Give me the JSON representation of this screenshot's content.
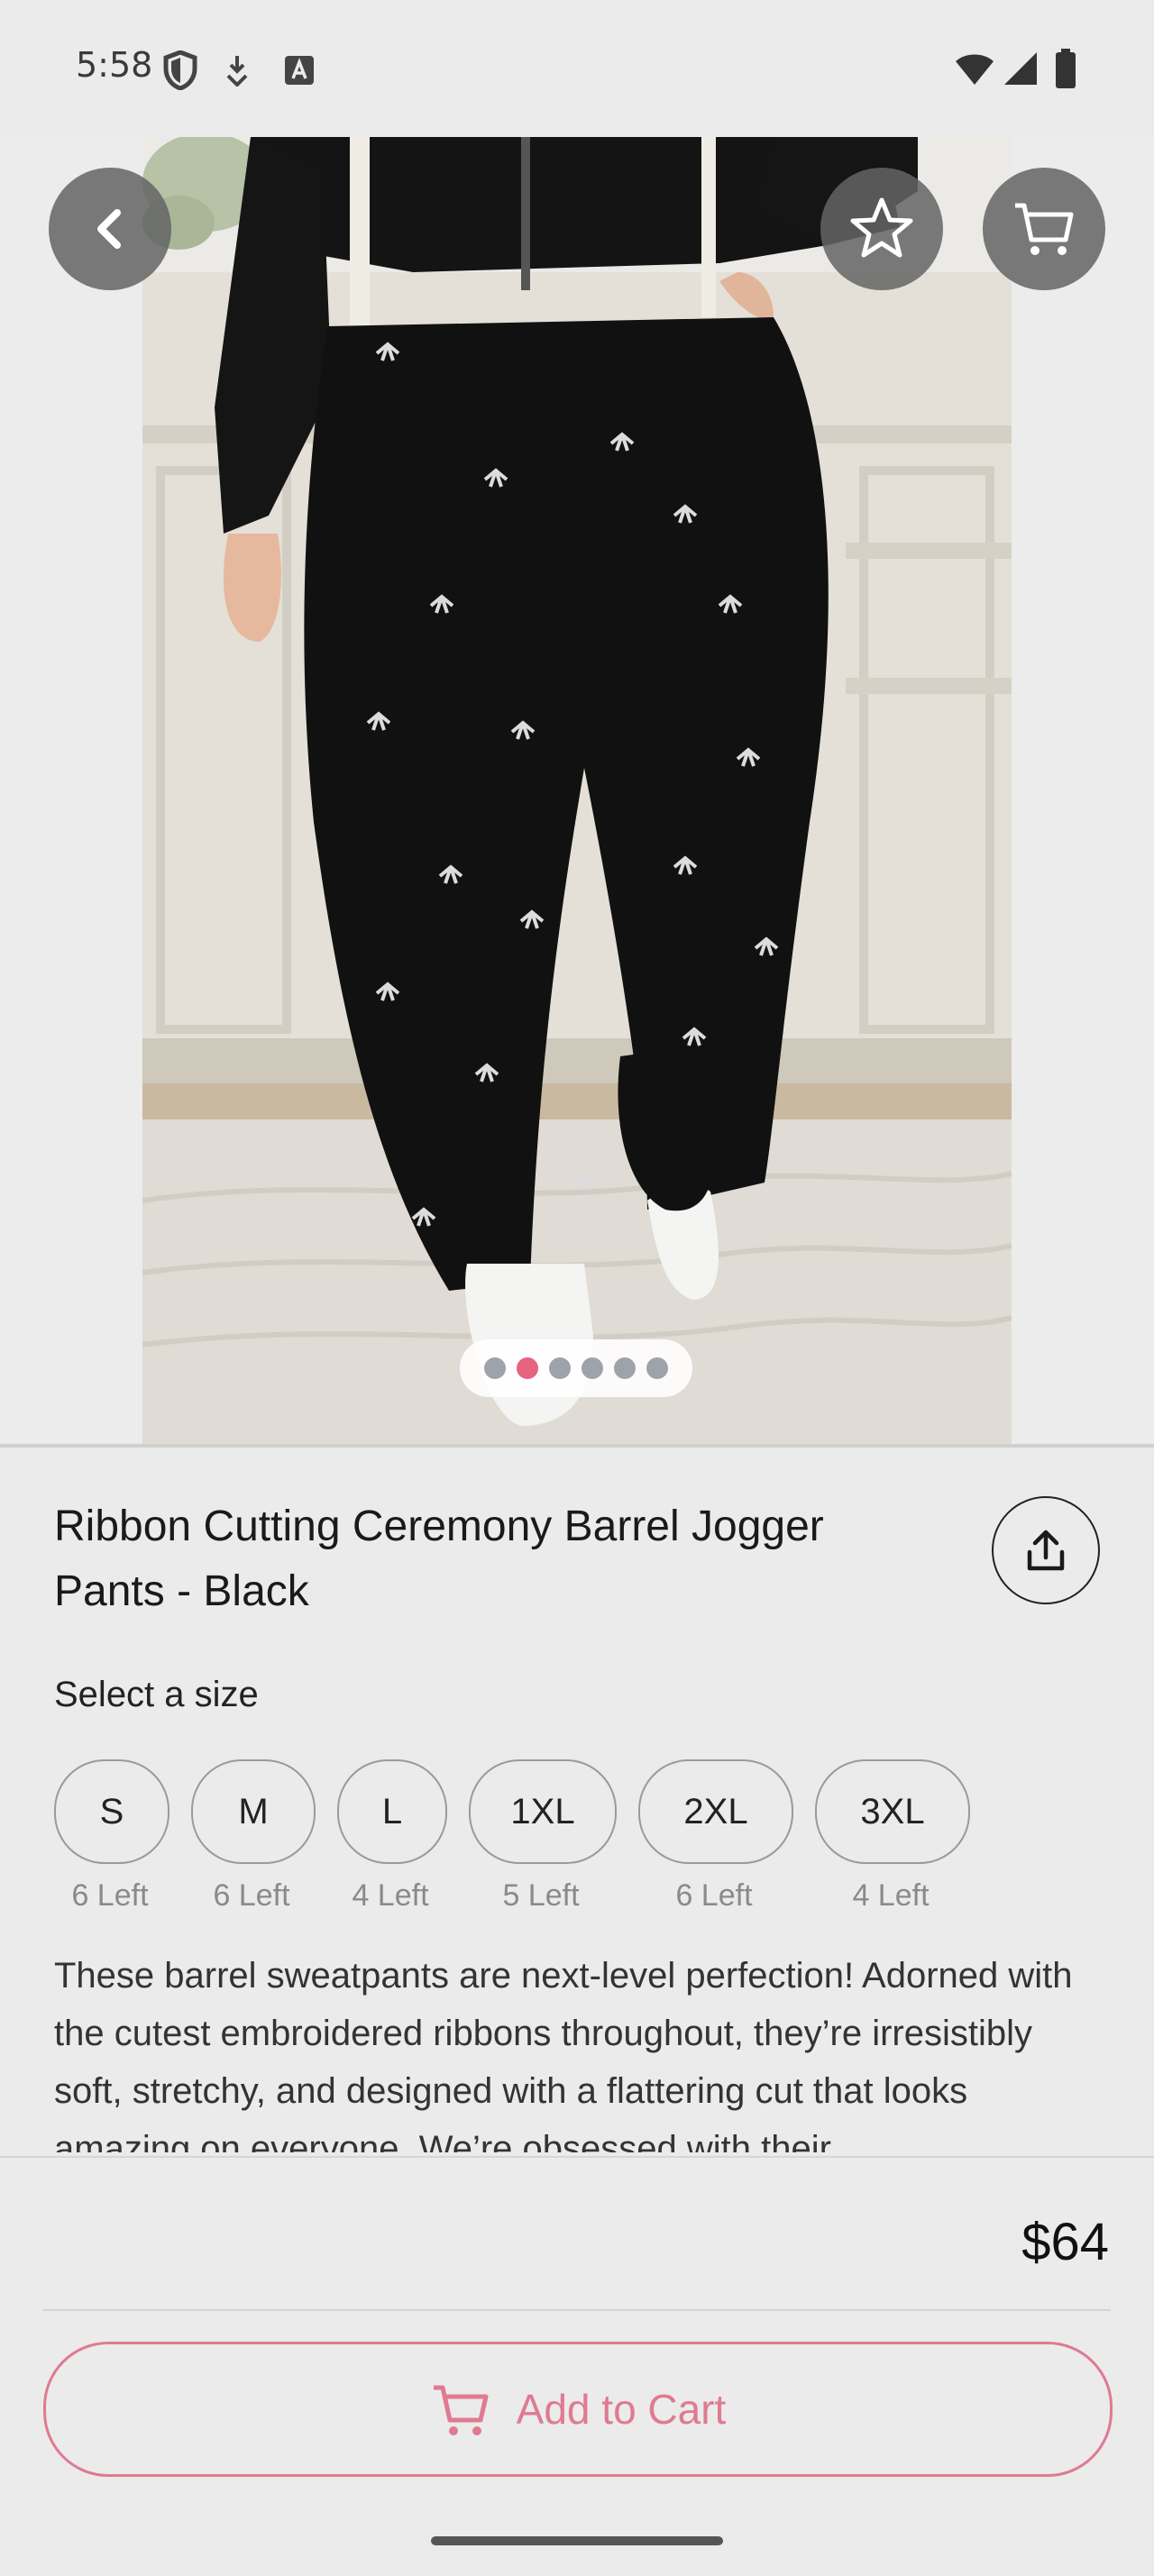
{
  "status_bar": {
    "time": "5:58"
  },
  "nav": {
    "back_icon": "chevron-left-icon",
    "favorite_icon": "star-icon",
    "cart_icon": "shopping-cart-icon"
  },
  "carousel": {
    "count": 6,
    "active_index": 1
  },
  "product": {
    "title": "Ribbon Cutting Ceremony Barrel Jogger Pants - Black",
    "share_icon": "share-icon",
    "select_size_label": "Select a size",
    "sizes": [
      {
        "label": "S",
        "stock": "6 Left"
      },
      {
        "label": "M",
        "stock": "6 Left"
      },
      {
        "label": "L",
        "stock": "4 Left"
      },
      {
        "label": "1XL",
        "stock": "5 Left"
      },
      {
        "label": "2XL",
        "stock": "6 Left"
      },
      {
        "label": "3XL",
        "stock": "4 Left"
      }
    ],
    "description": "These barrel sweatpants are next-level perfection! Adorned with the cutest embroidered ribbons throughout, they’re irresistibly soft, stretchy, and designed with a flattering cut that looks amazing on everyone. We’re obsessed with their"
  },
  "footer": {
    "price": "$64",
    "add_to_cart_label": "Add to Cart"
  },
  "colors": {
    "accent": "#e07a91",
    "carousel_active": "#e5647f"
  }
}
